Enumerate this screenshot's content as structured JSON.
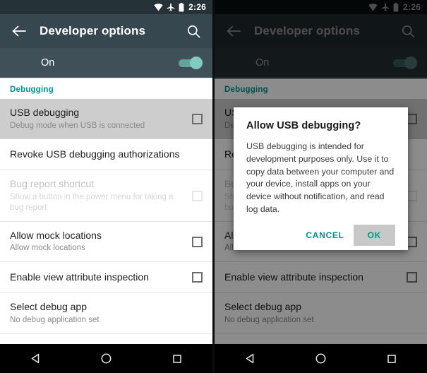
{
  "statusbar": {
    "time": "2:26",
    "icons": [
      "wifi-icon",
      "airplane-mode-icon",
      "battery-icon"
    ]
  },
  "toolbar": {
    "back_icon": "back-arrow-icon",
    "title": "Developer options",
    "search_icon": "search-icon"
  },
  "master_switch": {
    "label": "On",
    "state": "on"
  },
  "list": {
    "section_header": "Debugging",
    "rows": [
      {
        "title": "USB debugging",
        "subtitle": "Debug mode when USB is connected",
        "control": "checkbox",
        "checked": false,
        "highlighted": true,
        "disabled": false
      },
      {
        "title": "Revoke USB debugging authorizations",
        "subtitle": "",
        "control": "none",
        "checked": false,
        "highlighted": false,
        "disabled": false
      },
      {
        "title": "Bug report shortcut",
        "subtitle": "Show a button in the power menu for taking a bug report",
        "control": "checkbox",
        "checked": false,
        "highlighted": false,
        "disabled": true
      },
      {
        "title": "Allow mock locations",
        "subtitle": "Allow mock locations",
        "control": "checkbox",
        "checked": false,
        "highlighted": false,
        "disabled": false
      },
      {
        "title": "Enable view attribute inspection",
        "subtitle": "",
        "control": "checkbox",
        "checked": false,
        "highlighted": false,
        "disabled": false
      },
      {
        "title": "Select debug app",
        "subtitle": "No debug application set",
        "control": "none",
        "checked": false,
        "highlighted": false,
        "disabled": false
      }
    ]
  },
  "dialog": {
    "title": "Allow USB debugging?",
    "body": "USB debugging is intended for development purposes only. Use it to copy data between your computer and your device, install apps on your device without notification, and read log data.",
    "cancel_label": "CANCEL",
    "ok_label": "OK",
    "ok_pressed": true
  },
  "navbar": {
    "back_icon": "nav-back-triangle-icon",
    "home_icon": "nav-home-circle-icon",
    "recents_icon": "nav-recents-square-icon"
  },
  "colors": {
    "toolbar": "#37474F",
    "statusbar": "#263238",
    "accent_teal": "#009688",
    "toggle_on": "#80CBC4",
    "row_highlight": "#CDCDCD",
    "nav_background": "#000000"
  }
}
